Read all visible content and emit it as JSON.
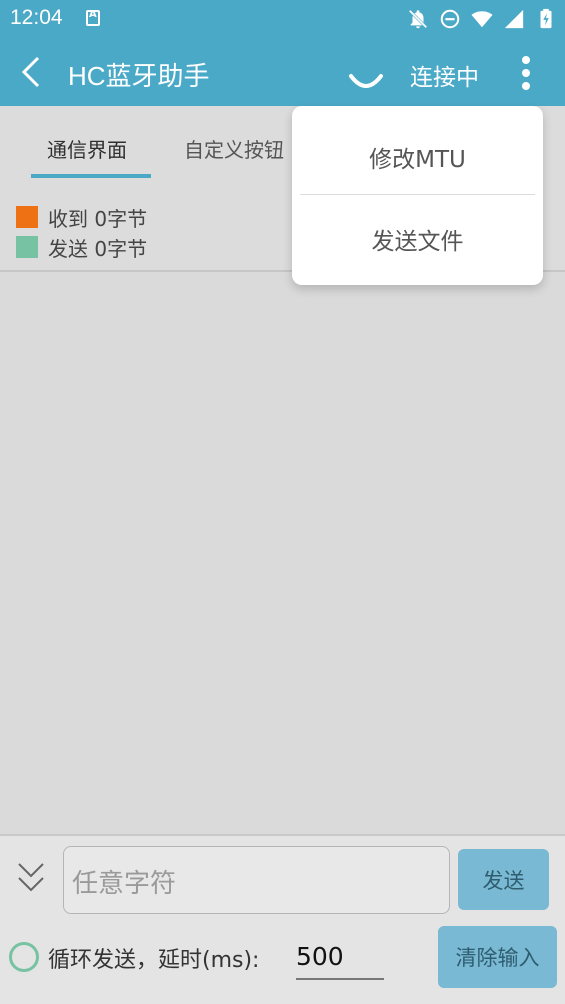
{
  "status_bar": {
    "time": "12:04",
    "icons": [
      "notification-a-icon",
      "bell-off-icon",
      "do-not-disturb-icon",
      "wifi-icon",
      "signal-icon",
      "battery-charging-icon"
    ]
  },
  "app_bar": {
    "title": "HC蓝牙助手",
    "connection_status": "连接中"
  },
  "tabs": [
    {
      "label": "通信界面",
      "active": true
    },
    {
      "label": "自定义按钮",
      "active": false
    }
  ],
  "legend": {
    "received": {
      "label": "收到",
      "count": "0字节",
      "color": "#ee7214"
    },
    "sent": {
      "label": "发送",
      "count": "0字节",
      "color": "#77c2a2"
    }
  },
  "bottom": {
    "input_placeholder": "任意字符",
    "send_label": "发送",
    "loop_label": "循环发送，延时(ms):",
    "delay_value": "500",
    "clear_label": "清除输入"
  },
  "menu": {
    "items": [
      {
        "label": "修改MTU"
      },
      {
        "label": "发送文件"
      }
    ]
  },
  "colors": {
    "accent": "#4ba9c8",
    "button": "#7ab9d3"
  }
}
